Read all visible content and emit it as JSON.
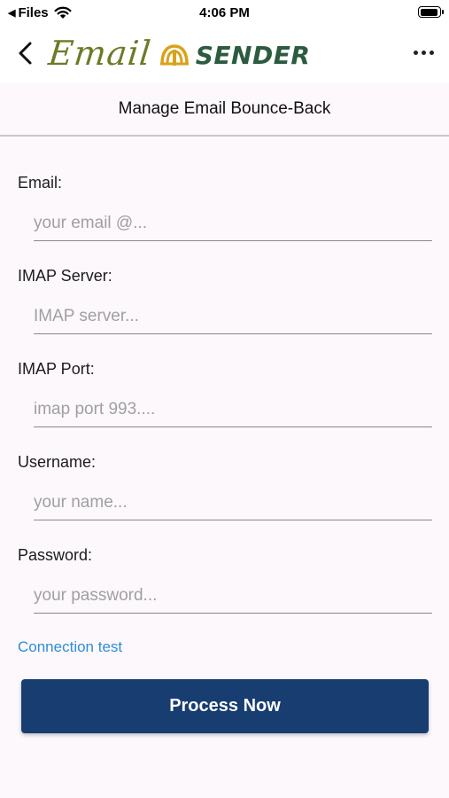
{
  "status_bar": {
    "back_app": "Files",
    "time": "4:06 PM"
  },
  "nav": {
    "logo_word1": "Email",
    "logo_word2": "SENDER",
    "icons": {
      "back": "chevron-left-icon",
      "more": "ellipsis-icon"
    },
    "colors": {
      "logo_green": "#6e7a26",
      "logo_dark": "#2c5b3f",
      "logo_gold": "#d9a21b"
    }
  },
  "page": {
    "title": "Manage Email Bounce-Back"
  },
  "form": {
    "fields": [
      {
        "label": "Email:",
        "placeholder": "your email @...",
        "value": ""
      },
      {
        "label": "IMAP Server:",
        "placeholder": "IMAP server...",
        "value": ""
      },
      {
        "label": "IMAP Port:",
        "placeholder": "imap port 993....",
        "value": ""
      },
      {
        "label": "Username:",
        "placeholder": "your name...",
        "value": ""
      },
      {
        "label": "Password:",
        "placeholder": "your password...",
        "value": ""
      }
    ]
  },
  "actions": {
    "connection_test": "Connection test",
    "process_now": "Process Now",
    "colors": {
      "link": "#2d8ed8",
      "button": "#173d71"
    }
  }
}
